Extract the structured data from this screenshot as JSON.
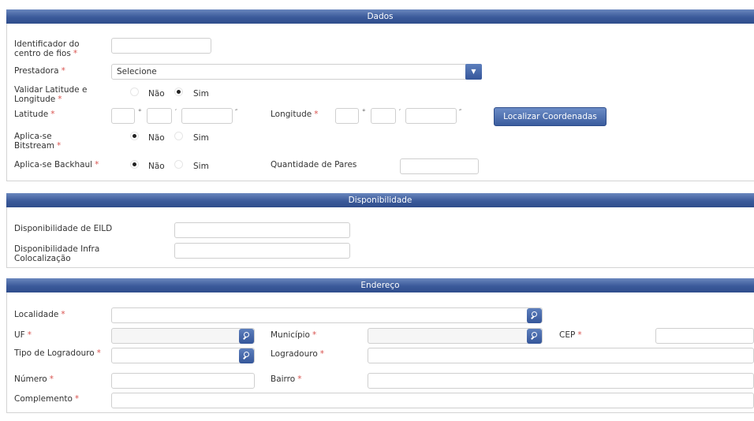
{
  "dados": {
    "header": "Dados",
    "identificador_label": "Identificador do centro de fios",
    "prestadora_label": "Prestadora",
    "prestadora_value": "Selecione",
    "validar_label": "Validar Latitude e Longitude",
    "latitude_label": "Latitude",
    "longitude_label": "Longitude",
    "deg": "°",
    "min": "′",
    "sec": "″",
    "localizar_button": "Localizar Coordenadas",
    "bitstream_label": "Aplica-se Bitstream",
    "backhaul_label": "Aplica-se Backhaul",
    "quantidade_label": "Quantidade de Pares",
    "nao": "Não",
    "sim": "Sim",
    "required_mark": "*",
    "validar_selected": "Sim",
    "bitstream_selected": "Não",
    "backhaul_selected": "Não"
  },
  "disponibilidade": {
    "header": "Disponibilidade",
    "eild_label": "Disponibilidade de EILD",
    "infra_label": "Disponibilidade Infra Colocalização"
  },
  "endereco": {
    "header": "Endereço",
    "localidade_label": "Localidade",
    "uf_label": "UF",
    "municipio_label": "Município",
    "cep_label": "CEP",
    "tipo_logradouro_label": "Tipo de Logradouro",
    "logradouro_label": "Logradouro",
    "numero_label": "Número",
    "bairro_label": "Bairro",
    "complemento_label": "Complemento"
  },
  "icons": {
    "search": "search-icon",
    "dropdown": "chevron-down-icon"
  },
  "colors": {
    "header": "#3b5a9a",
    "button": "#4a6aab",
    "required": "#d9534f"
  }
}
